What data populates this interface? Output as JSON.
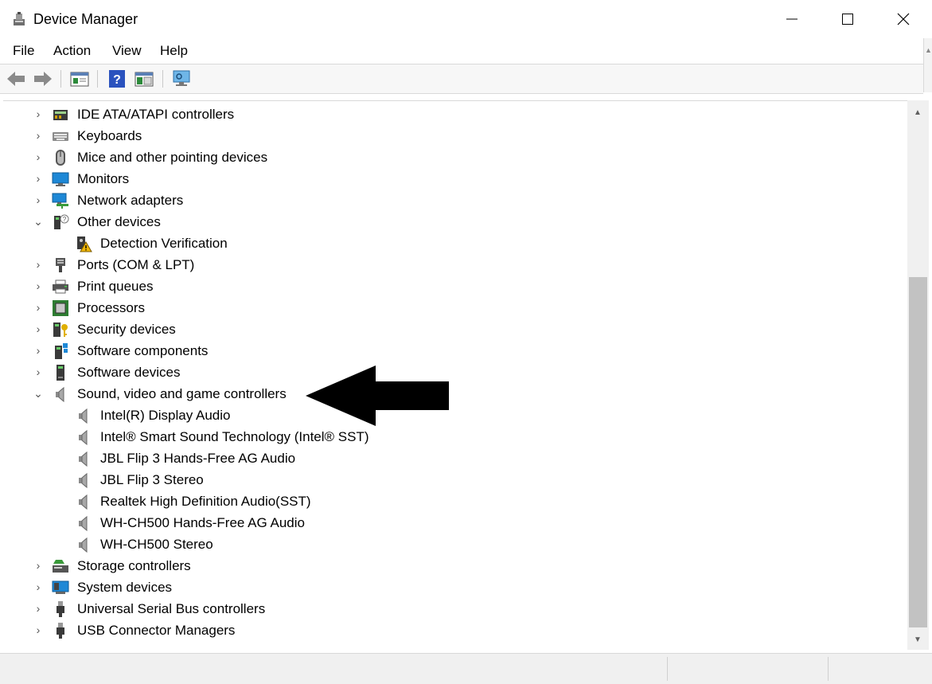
{
  "window": {
    "title": "Device Manager",
    "controls": {
      "minimize": "minimize-icon",
      "maximize": "maximize-icon",
      "close": "close-icon"
    }
  },
  "menu": [
    {
      "label": "File"
    },
    {
      "label": "Action"
    },
    {
      "label": "View"
    },
    {
      "label": "Help"
    }
  ],
  "toolbar": {
    "buttons": [
      "back-arrow-icon",
      "forward-arrow-icon",
      "properties-icon",
      "help-icon",
      "view-icon",
      "scan-hardware-icon"
    ]
  },
  "tree": {
    "items": [
      {
        "label": "IDE ATA/ATAPI controllers",
        "icon": "ide-controller-icon",
        "level": 0,
        "expanded": false
      },
      {
        "label": "Keyboards",
        "icon": "keyboard-icon",
        "level": 0,
        "expanded": false
      },
      {
        "label": "Mice and other pointing devices",
        "icon": "mouse-icon",
        "level": 0,
        "expanded": false
      },
      {
        "label": "Monitors",
        "icon": "monitor-icon",
        "level": 0,
        "expanded": false
      },
      {
        "label": "Network adapters",
        "icon": "network-icon",
        "level": 0,
        "expanded": false
      },
      {
        "label": "Other devices",
        "icon": "unknown-device-icon",
        "level": 0,
        "expanded": true
      },
      {
        "label": "Detection Verification",
        "icon": "warning-device-icon",
        "level": 1
      },
      {
        "label": "Ports (COM & LPT)",
        "icon": "port-icon",
        "level": 0,
        "expanded": false
      },
      {
        "label": "Print queues",
        "icon": "printer-icon",
        "level": 0,
        "expanded": false
      },
      {
        "label": "Processors",
        "icon": "processor-icon",
        "level": 0,
        "expanded": false
      },
      {
        "label": "Security devices",
        "icon": "security-key-icon",
        "level": 0,
        "expanded": false
      },
      {
        "label": "Software components",
        "icon": "software-component-icon",
        "level": 0,
        "expanded": false
      },
      {
        "label": "Software devices",
        "icon": "software-device-icon",
        "level": 0,
        "expanded": false
      },
      {
        "label": "Sound, video and game controllers",
        "icon": "speaker-icon",
        "level": 0,
        "expanded": true
      },
      {
        "label": "Intel(R) Display Audio",
        "icon": "speaker-icon",
        "level": 1
      },
      {
        "label": "Intel® Smart Sound Technology (Intel® SST)",
        "icon": "speaker-icon",
        "level": 1
      },
      {
        "label": "JBL Flip 3 Hands-Free AG Audio",
        "icon": "speaker-icon",
        "level": 1
      },
      {
        "label": "JBL Flip 3 Stereo",
        "icon": "speaker-icon",
        "level": 1
      },
      {
        "label": "Realtek High Definition Audio(SST)",
        "icon": "speaker-icon",
        "level": 1
      },
      {
        "label": "WH-CH500 Hands-Free AG Audio",
        "icon": "speaker-icon",
        "level": 1
      },
      {
        "label": "WH-CH500 Stereo",
        "icon": "speaker-icon",
        "level": 1
      },
      {
        "label": "Storage controllers",
        "icon": "storage-icon",
        "level": 0,
        "expanded": false
      },
      {
        "label": "System devices",
        "icon": "system-device-icon",
        "level": 0,
        "expanded": false
      },
      {
        "label": "Universal Serial Bus controllers",
        "icon": "usb-icon",
        "level": 0,
        "expanded": false
      },
      {
        "label": "USB Connector Managers",
        "icon": "usb-icon",
        "level": 0,
        "expanded": false
      }
    ]
  },
  "annotation": {
    "icon": "pointer-arrow-icon",
    "color": "#000000"
  }
}
